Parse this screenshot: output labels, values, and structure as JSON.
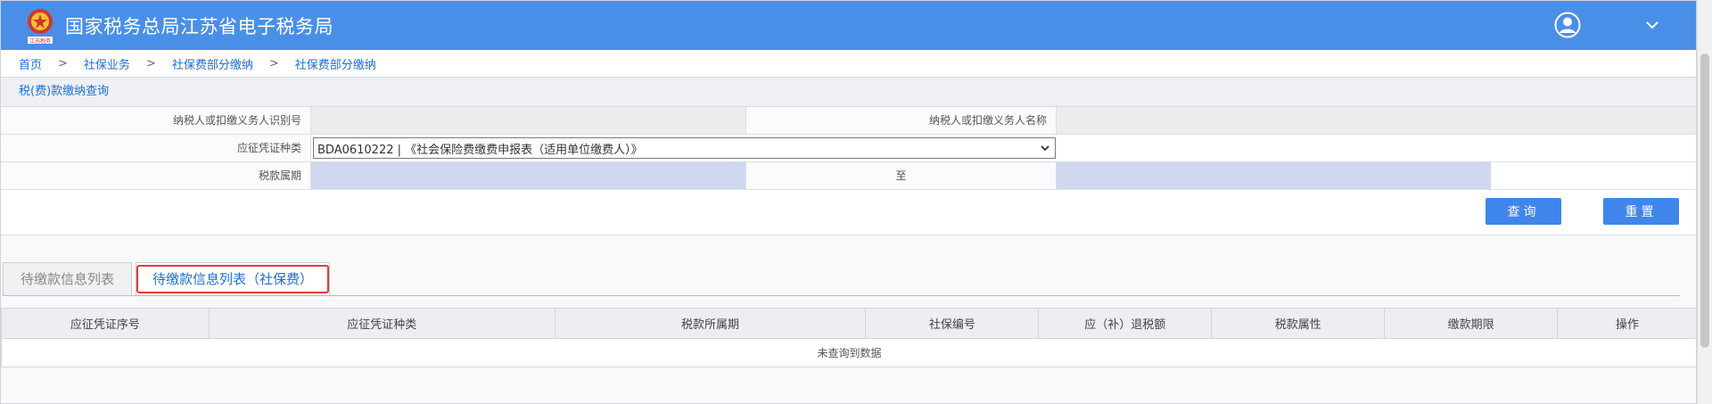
{
  "header": {
    "title": "国家税务总局江苏省电子税务局",
    "logo_caption": "江苏税务",
    "accent": "#4a8fe7"
  },
  "breadcrumb": [
    "首页",
    "社保业务",
    "社保费部分缴纳",
    "社保费部分缴纳"
  ],
  "breadcrumb_sep": ">",
  "panel": {
    "title": "税(费)款缴纳查询",
    "taxpayer_id_label": "纳税人或扣缴义务人识别号",
    "taxpayer_name_label": "纳税人或扣缴义务人名称",
    "voucher_type_label": "应征凭证种类",
    "voucher_type_value": "BDA0610222 | 《社会保险费缴费申报表（适用单位缴费人）》",
    "period_label": "税款属期",
    "to_label": "至"
  },
  "buttons": {
    "query": "查询",
    "reset": "重置"
  },
  "tabs": [
    {
      "label": "待缴款信息列表",
      "active": false
    },
    {
      "label": "待缴款信息列表（社保费）",
      "active": true
    }
  ],
  "table": {
    "columns": [
      "应征凭证序号",
      "应征凭证种类",
      "税款所属期",
      "社保编号",
      "应（补）退税额",
      "税款属性",
      "缴款期限",
      "操作"
    ],
    "empty_text": "未查询到数据"
  }
}
